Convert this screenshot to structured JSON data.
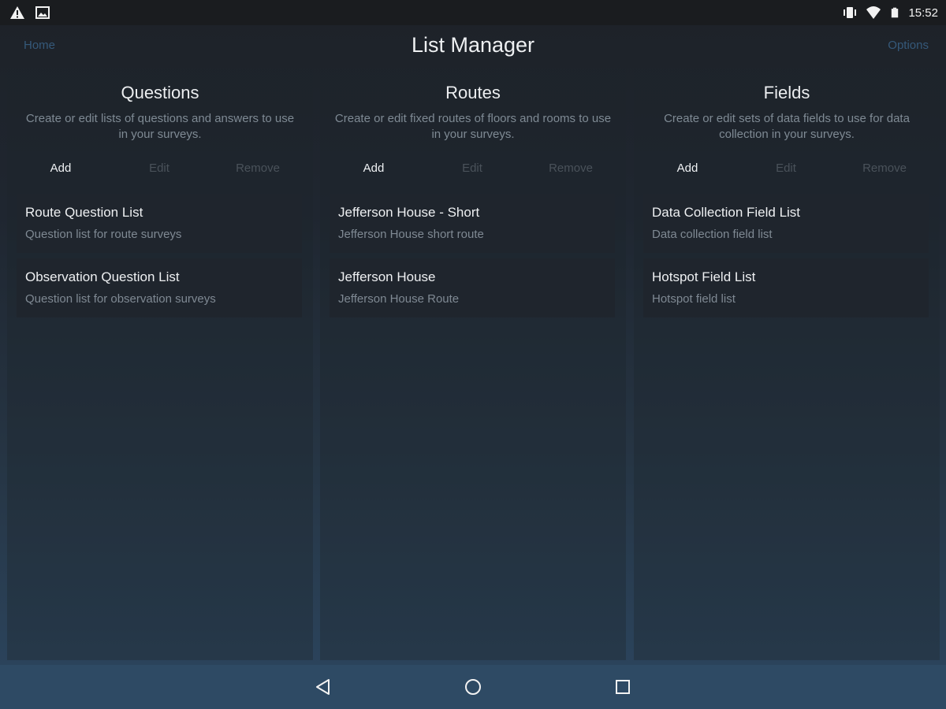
{
  "status_bar": {
    "time": "15:52",
    "left_icons": [
      "warning-icon",
      "image-icon"
    ],
    "right_icons": [
      "vibrate-icon",
      "wifi-icon",
      "battery-icon"
    ]
  },
  "header": {
    "home_label": "Home",
    "title": "List Manager",
    "options_label": "Options"
  },
  "panels": [
    {
      "title": "Questions",
      "description": "Create or edit lists of questions and answers to use in your surveys.",
      "actions": {
        "add": "Add",
        "edit": "Edit",
        "remove": "Remove"
      },
      "items": [
        {
          "title": "Route Question List",
          "subtitle": "Question list for route surveys"
        },
        {
          "title": "Observation Question List",
          "subtitle": "Question list for observation surveys"
        }
      ]
    },
    {
      "title": "Routes",
      "description": "Create or edit fixed routes of floors and rooms to use in your surveys.",
      "actions": {
        "add": "Add",
        "edit": "Edit",
        "remove": "Remove"
      },
      "items": [
        {
          "title": "Jefferson House - Short",
          "subtitle": "Jefferson House short route"
        },
        {
          "title": "Jefferson House",
          "subtitle": "Jefferson House Route"
        }
      ]
    },
    {
      "title": "Fields",
      "description": "Create or edit sets of data fields to use for data collection in your surveys.",
      "actions": {
        "add": "Add",
        "edit": "Edit",
        "remove": "Remove"
      },
      "items": [
        {
          "title": "Data Collection Field List",
          "subtitle": "Data collection field list"
        },
        {
          "title": "Hotspot Field List",
          "subtitle": "Hotspot field list"
        }
      ]
    }
  ],
  "nav_bar": {
    "buttons": [
      "back-icon",
      "home-icon",
      "recents-icon"
    ]
  },
  "colors": {
    "link": "#35597a",
    "disabled_action": "#4a525a",
    "nav_bar": "#2e4a64"
  }
}
